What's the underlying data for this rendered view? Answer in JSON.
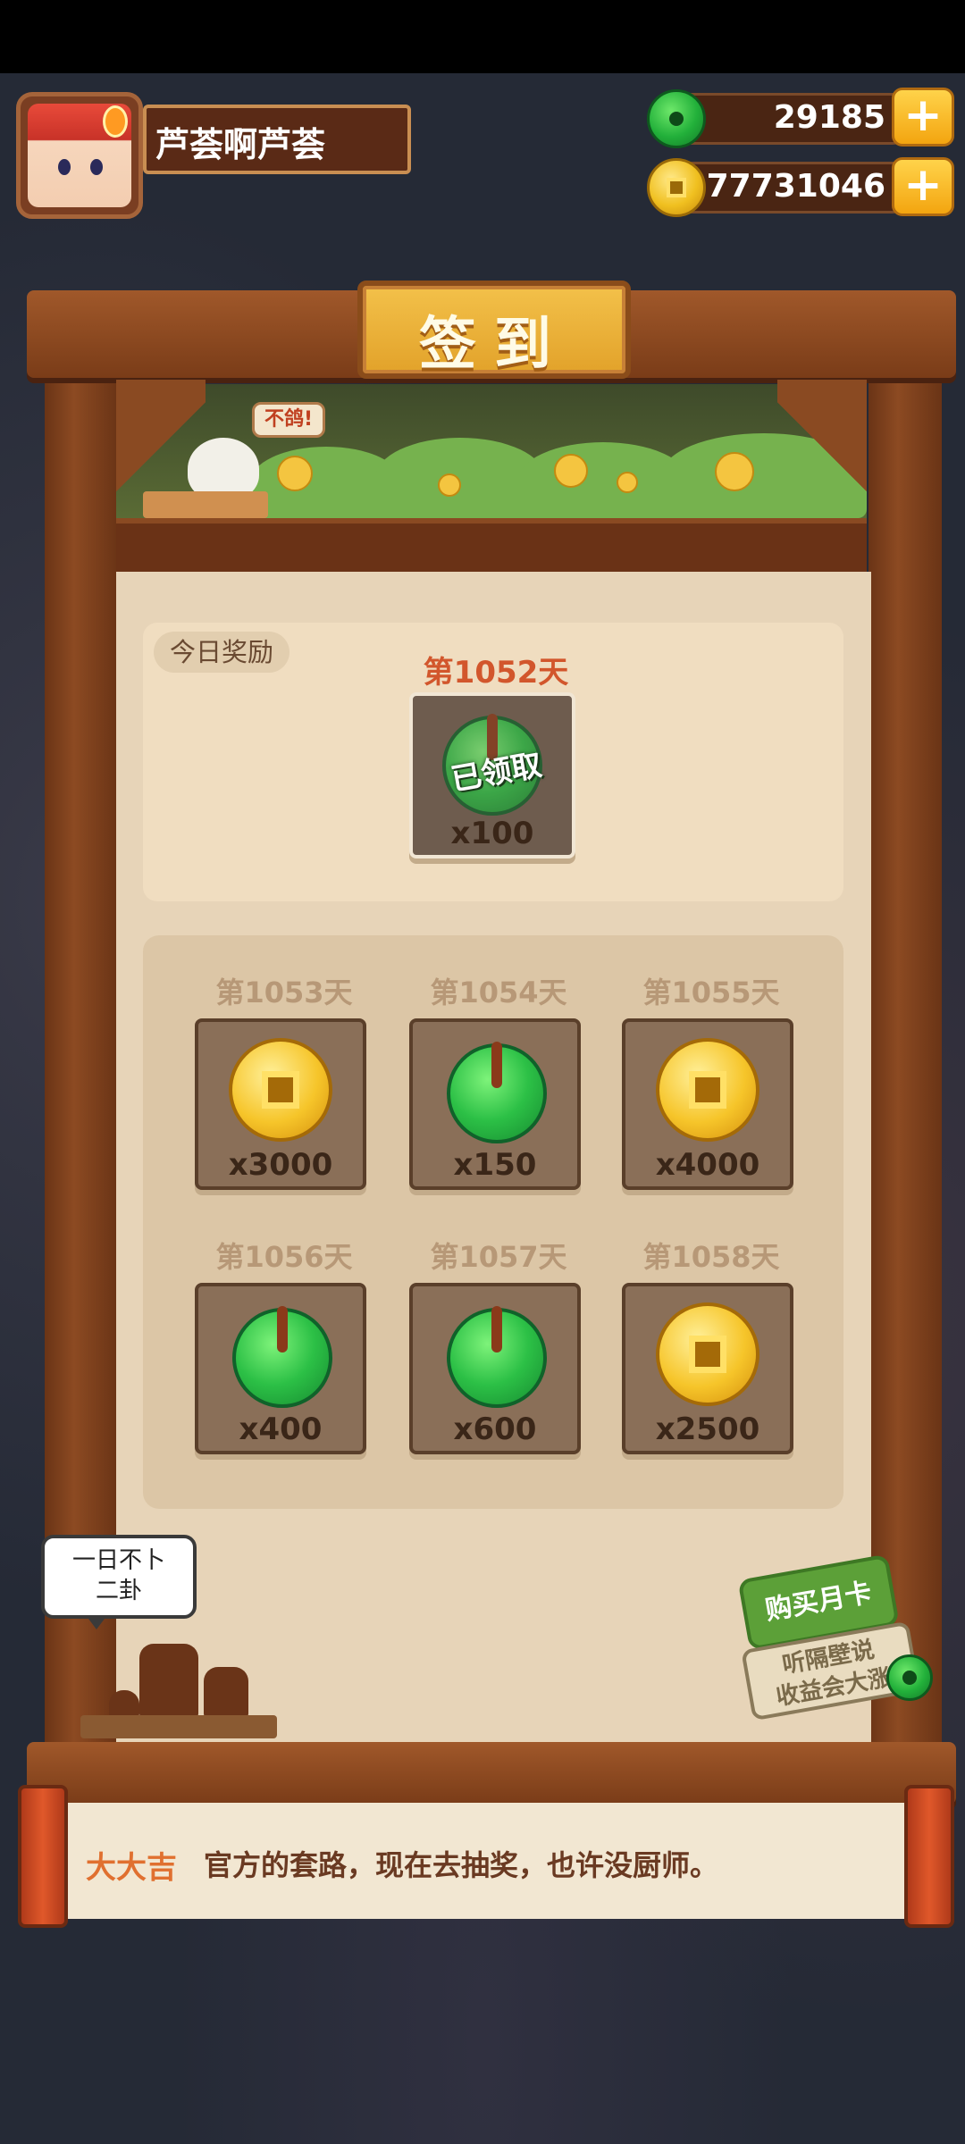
{
  "player": {
    "name": "芦荟啊芦荟"
  },
  "currencies": [
    {
      "name": "jade",
      "value": "29185",
      "icon": "jade-coin-icon"
    },
    {
      "name": "gold",
      "value": "77731046",
      "icon": "gold-coin-icon"
    }
  ],
  "dialog": {
    "title": "签到",
    "bird_speech": "不鸽!",
    "today": {
      "tag": "今日奖励",
      "day": "第1052天",
      "reward": {
        "type": "jade",
        "qty": "x100",
        "status": "已领取"
      }
    },
    "upcoming": [
      {
        "day": "第1053天",
        "type": "gold",
        "qty": "x3000"
      },
      {
        "day": "第1054天",
        "type": "jade",
        "qty": "x150"
      },
      {
        "day": "第1055天",
        "type": "gold",
        "qty": "x4000"
      },
      {
        "day": "第1056天",
        "type": "jade",
        "qty": "x400"
      },
      {
        "day": "第1057天",
        "type": "jade",
        "qty": "x600"
      },
      {
        "day": "第1058天",
        "type": "gold",
        "qty": "x2500"
      }
    ]
  },
  "shopkeeper_speech": {
    "line1": "一日不卜",
    "line2": "二卦"
  },
  "monthly_card": {
    "title": "购买月卡",
    "line1": "听隔壁说",
    "line2": "收益会大涨"
  },
  "fortune": {
    "level": "大大吉",
    "text": "官方的套路，现在去抽奖，也许没厨师。"
  },
  "colors": {
    "accent_gold": "#f3c14a",
    "wood": "#7a3c18",
    "today_day": "#d2562c",
    "fortune_level": "#e07030"
  }
}
